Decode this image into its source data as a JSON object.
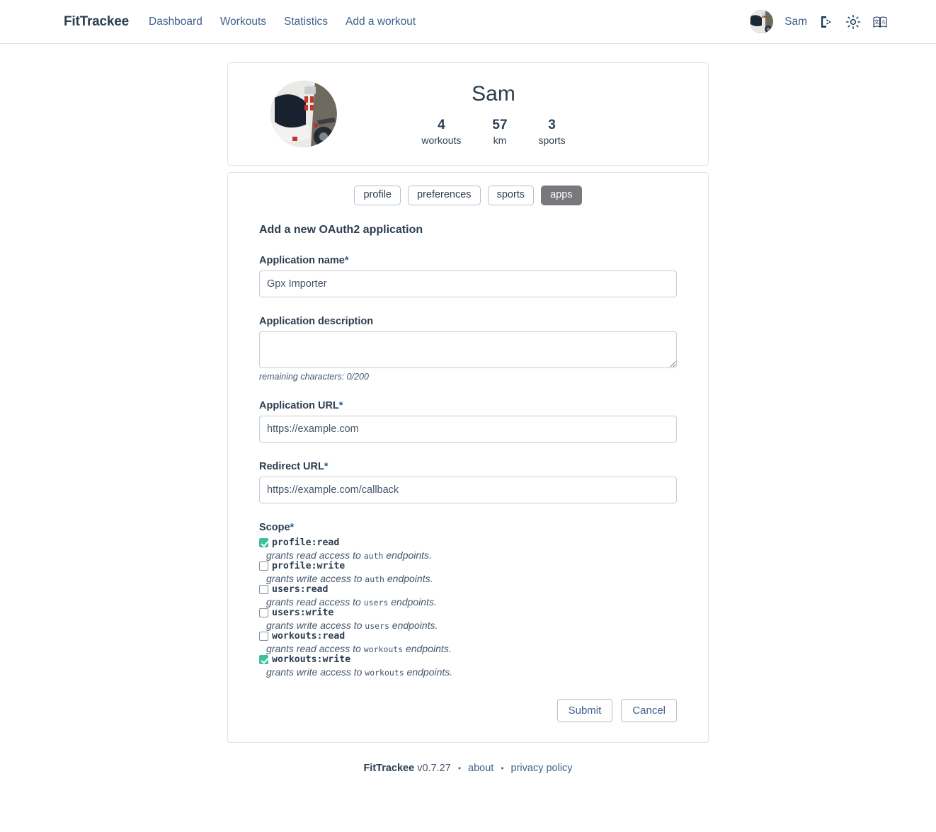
{
  "nav": {
    "brand": "FitTrackee",
    "links": [
      {
        "label": "Dashboard"
      },
      {
        "label": "Workouts"
      },
      {
        "label": "Statistics"
      },
      {
        "label": "Add a workout"
      }
    ],
    "username": "Sam",
    "icons": {
      "logout": "logout-icon",
      "theme": "sun-icon",
      "language": "language-icon"
    }
  },
  "user_card": {
    "name": "Sam",
    "stats": [
      {
        "value": "4",
        "label": "workouts"
      },
      {
        "value": "57",
        "label": "km"
      },
      {
        "value": "3",
        "label": "sports"
      }
    ]
  },
  "tabs": [
    {
      "label": "profile",
      "active": false
    },
    {
      "label": "preferences",
      "active": false
    },
    {
      "label": "sports",
      "active": false
    },
    {
      "label": "apps",
      "active": true
    }
  ],
  "form": {
    "title": "Add a new OAuth2 application",
    "app_name": {
      "label": "Application name",
      "required": "*",
      "value": "Gpx Importer",
      "placeholder": ""
    },
    "app_description": {
      "label": "Application description",
      "required": "",
      "value": "",
      "placeholder": "",
      "hint": "remaining characters: 0/200"
    },
    "app_url": {
      "label": "Application URL",
      "required": "*",
      "value": "https://example.com",
      "placeholder": ""
    },
    "redirect_url": {
      "label": "Redirect URL",
      "required": "*",
      "value": "https://example.com/callback",
      "placeholder": ""
    },
    "scope": {
      "label": "Scope",
      "required": "*",
      "items": [
        {
          "name": "profile:read",
          "checked": true,
          "desc_before": "grants read access to ",
          "desc_code": "auth",
          "desc_after": " endpoints."
        },
        {
          "name": "profile:write",
          "checked": false,
          "desc_before": "grants write access to ",
          "desc_code": "auth",
          "desc_after": " endpoints."
        },
        {
          "name": "users:read",
          "checked": false,
          "desc_before": "grants read access to ",
          "desc_code": "users",
          "desc_after": " endpoints."
        },
        {
          "name": "users:write",
          "checked": false,
          "desc_before": "grants write access to ",
          "desc_code": "users",
          "desc_after": " endpoints."
        },
        {
          "name": "workouts:read",
          "checked": false,
          "desc_before": "grants read access to ",
          "desc_code": "workouts",
          "desc_after": " endpoints."
        },
        {
          "name": "workouts:write",
          "checked": true,
          "desc_before": "grants write access to ",
          "desc_code": "workouts",
          "desc_after": " endpoints."
        }
      ]
    },
    "submit_label": "Submit",
    "cancel_label": "Cancel"
  },
  "footer": {
    "app": "FitTrackee",
    "version": "v0.7.27",
    "separator": "•",
    "about": "about",
    "privacy": "privacy policy"
  },
  "colors": {
    "accent_blue": "#40618c",
    "text_dark": "#2c3e50",
    "checkbox_green": "#3fbf9c",
    "tab_active_bg": "#77797c",
    "border": "#dfe3e8"
  }
}
